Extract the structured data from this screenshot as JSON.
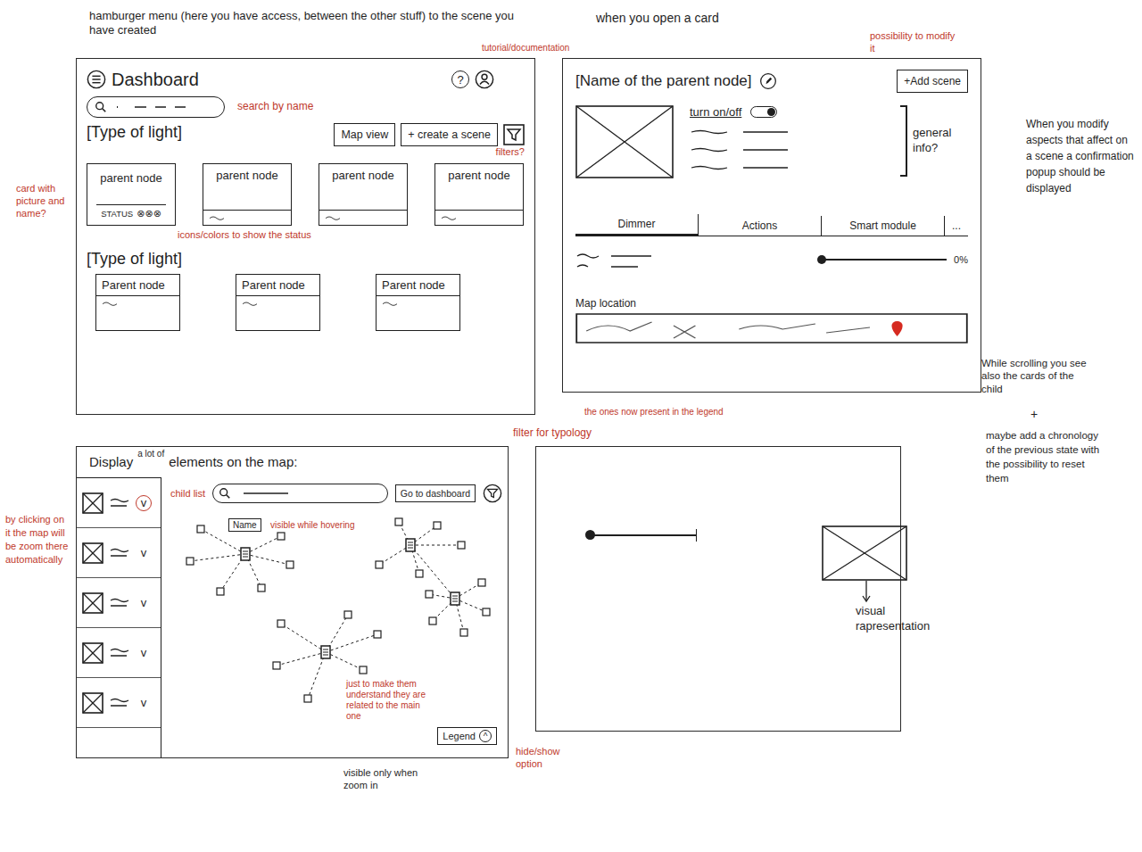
{
  "notes": {
    "hamburger": {
      "text": "hamburger menu (here you have access, between the other stuff) to the scene you have created",
      "color": "#1f1f1f"
    },
    "search": {
      "text": "search by name",
      "color": "#c0392b"
    },
    "tutorial": {
      "text": "tutorial/documentation",
      "color": "#c0392b"
    },
    "filters": {
      "text": "filters?",
      "color": "#c0392b"
    },
    "card": {
      "text": "card with picture and name?",
      "color": "#c0392b"
    },
    "status": {
      "text": "icons/colors to show the status",
      "color": "#c0392b"
    },
    "open_card": {
      "text": "when you open a card",
      "color": "#1f1f1f"
    },
    "modify": {
      "text": "possibility to modify it",
      "color": "#c0392b"
    },
    "confirm": {
      "text": "When you modify aspects that affect on a scene a confirmation popup should be displayed",
      "color": "#1f1f1f"
    },
    "scrolling": {
      "text": "While scrolling you see also the cards of the child",
      "color": "#1f1f1f"
    },
    "plus": {
      "text": "+",
      "color": "#1f1f1f"
    },
    "chronology": {
      "text": "maybe add a chronology of the previous state with the possibility to reset them",
      "color": "#1f1f1f"
    },
    "typology": {
      "text": "filter for typology",
      "color": "#c0392b"
    },
    "legend_items": {
      "text": "the ones now present in the legend",
      "color": "#c0392b"
    },
    "child_list": {
      "text": "child list",
      "color": "#c0392b"
    },
    "zoom_click": {
      "text": "by clicking on it the map will be zoom there automatically",
      "color": "#c0392b"
    },
    "hovering": {
      "text": "visible while hovering",
      "color": "#c0392b"
    },
    "related": {
      "text": "just to make them understand they are related to the main one",
      "color": "#c0392b"
    },
    "hide_show": {
      "text": "hide/show option",
      "color": "#c0392b"
    },
    "zoom_only": {
      "text": "visible only when zoom in",
      "color": "#1f1f1f"
    },
    "visual": {
      "text": "visual rapresentation",
      "color": "#1f1f1f"
    }
  },
  "dashboard": {
    "title": "Dashboard",
    "help": "?",
    "buttons": [
      "Map view",
      "+ create a scene"
    ],
    "sections": [
      {
        "title": "[Type of light]",
        "cards": [
          {
            "name": "parent node",
            "kind": "status",
            "status": "STATUS",
            "status_icons": "⊗⊗⊗"
          },
          {
            "name": "parent node",
            "kind": "plain"
          },
          {
            "name": "parent node",
            "kind": "plain"
          },
          {
            "name": "parent node",
            "kind": "plain"
          }
        ]
      },
      {
        "title": "[Type of light]",
        "cards": [
          {
            "name": "Parent node",
            "kind": "plain"
          },
          {
            "name": "Parent node",
            "kind": "plain"
          },
          {
            "name": "Parent node",
            "kind": "plain"
          }
        ]
      }
    ]
  },
  "detail": {
    "title": "[Name of the parent node]",
    "add_button": "+Add scene",
    "toggle": {
      "label": "turn on/off",
      "on": true
    },
    "info": "general info?",
    "tabs": [
      {
        "label": "Dimmer",
        "selected": true
      },
      {
        "label": "Actions",
        "selected": false
      },
      {
        "label": "Smart module",
        "selected": false
      }
    ],
    "more": "...",
    "slider": {
      "level": 0,
      "reading": "0%"
    },
    "map_label": "Map location"
  },
  "map_view": {
    "title": "Display",
    "title_insert": "a lot of",
    "title_rest": "elements on the map:",
    "go_button": "Go to dashboard",
    "children": [
      {
        "arrow": "v",
        "highlighted": true
      },
      {
        "arrow": "v",
        "highlighted": false
      },
      {
        "arrow": "v",
        "highlighted": false
      },
      {
        "arrow": "v",
        "highlighted": false
      },
      {
        "arrow": "v",
        "highlighted": false
      }
    ],
    "tooltip": "Name",
    "legend": {
      "label": "Legend",
      "toggle": "^"
    }
  },
  "preview": {
    "slider": {
      "level": 0
    }
  }
}
